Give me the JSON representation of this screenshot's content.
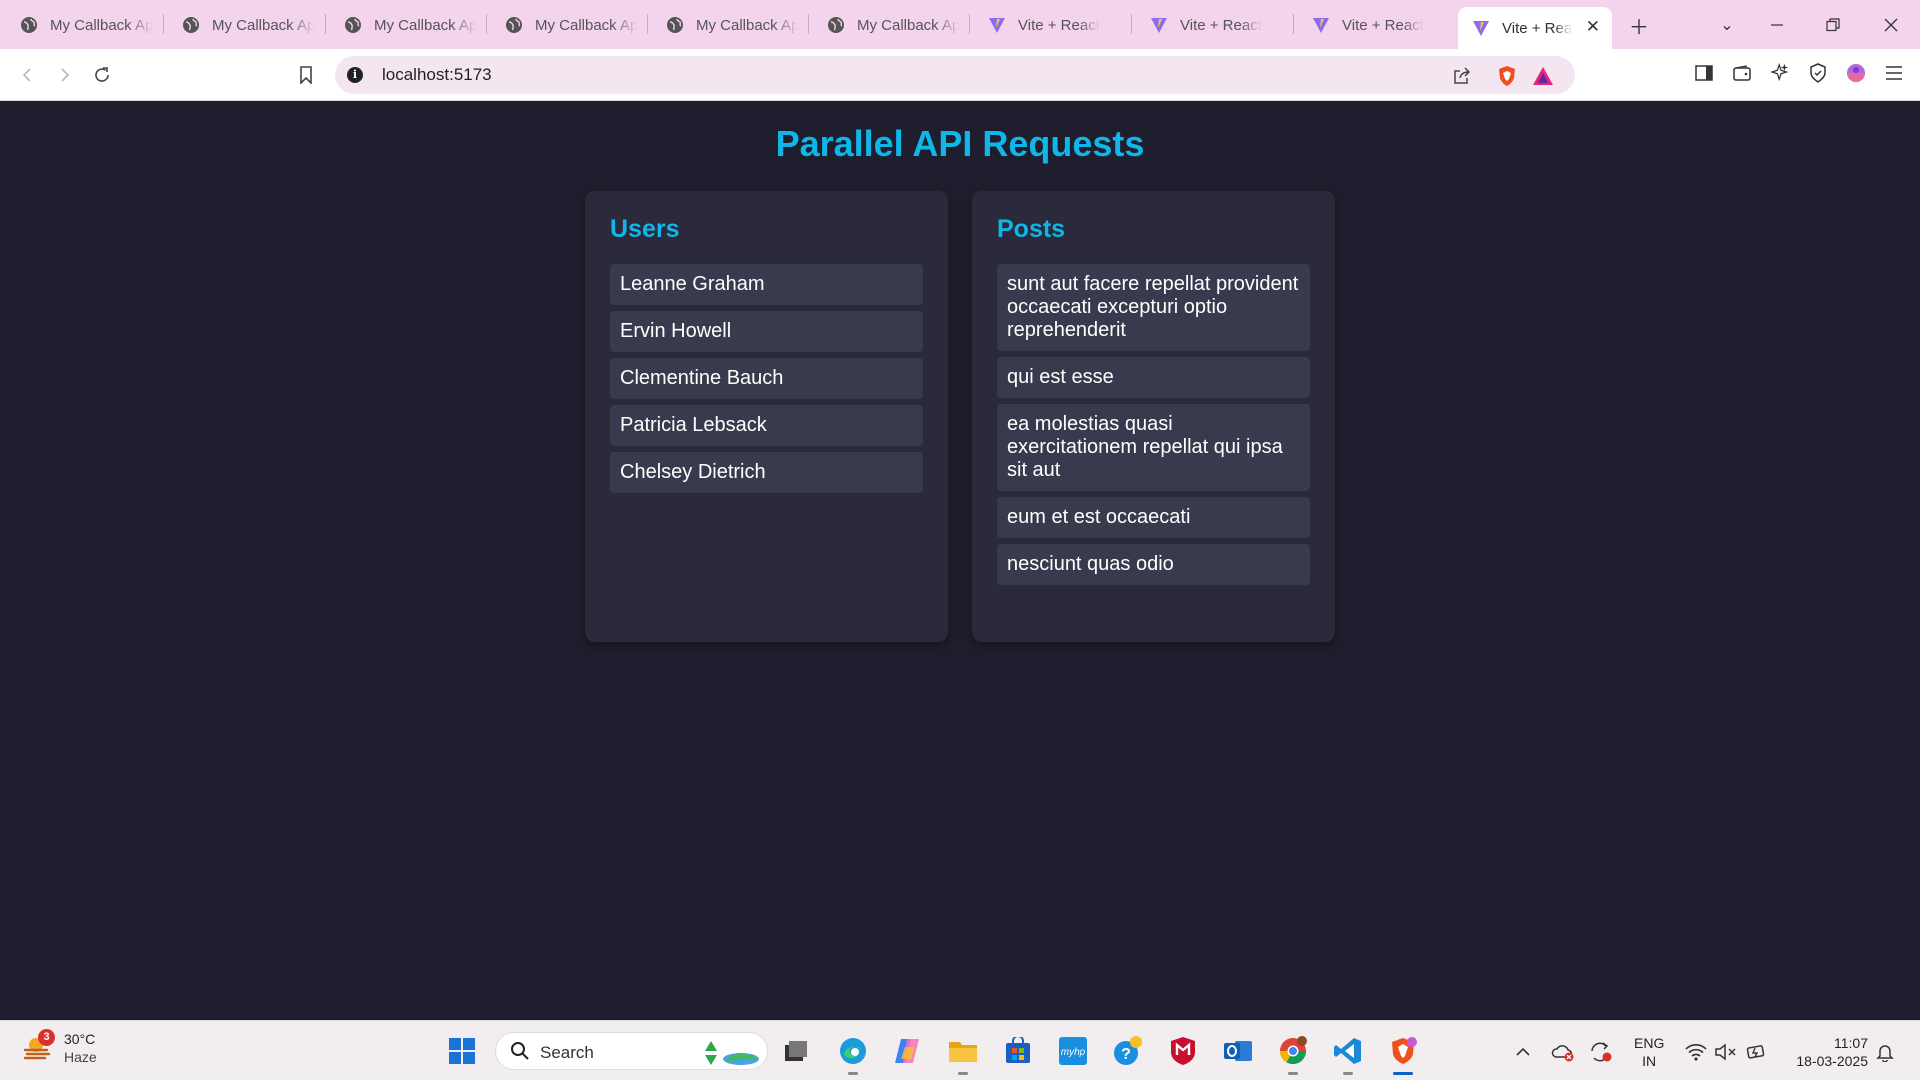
{
  "browser": {
    "tabs": [
      {
        "title": "My Callback Ap",
        "icon": "globe-icon"
      },
      {
        "title": "My Callback Ap",
        "icon": "globe-icon"
      },
      {
        "title": "My Callback Ap",
        "icon": "globe-icon"
      },
      {
        "title": "My Callback Ap",
        "icon": "globe-icon"
      },
      {
        "title": "My Callback Ap",
        "icon": "globe-icon"
      },
      {
        "title": "My Callback Ap",
        "icon": "globe-icon"
      },
      {
        "title": "Vite + React",
        "icon": "vite-icon"
      },
      {
        "title": "Vite + React",
        "icon": "vite-icon"
      },
      {
        "title": "Vite + React",
        "icon": "vite-icon"
      },
      {
        "title": "Vite + Rea",
        "icon": "vite-icon",
        "active": true
      }
    ],
    "url": "localhost:5173",
    "colors": {
      "tabstrip": "#f4d4ec",
      "omnibox": "#f4e6f0"
    }
  },
  "page": {
    "title": "Parallel API Requests",
    "users": {
      "heading": "Users",
      "items": [
        "Leanne Graham",
        "Ervin Howell",
        "Clementine Bauch",
        "Patricia Lebsack",
        "Chelsey Dietrich"
      ]
    },
    "posts": {
      "heading": "Posts",
      "items": [
        "sunt aut facere repellat provident occaecati excepturi optio reprehenderit",
        "qui est esse",
        "ea molestias quasi exercitationem repellat qui ipsa sit aut",
        "eum et est occaecati",
        "nesciunt quas odio"
      ]
    },
    "colors": {
      "background": "#1e1e2e",
      "card": "#2a2a3a",
      "item": "#3a3a4e",
      "accent": "#0fb6e8"
    }
  },
  "taskbar": {
    "weather": {
      "temp": "30°C",
      "condition": "Haze",
      "badge": "3"
    },
    "search_label": "Search",
    "language": {
      "line1": "ENG",
      "line2": "IN"
    },
    "clock": {
      "time": "11:07",
      "date": "18-03-2025"
    }
  }
}
